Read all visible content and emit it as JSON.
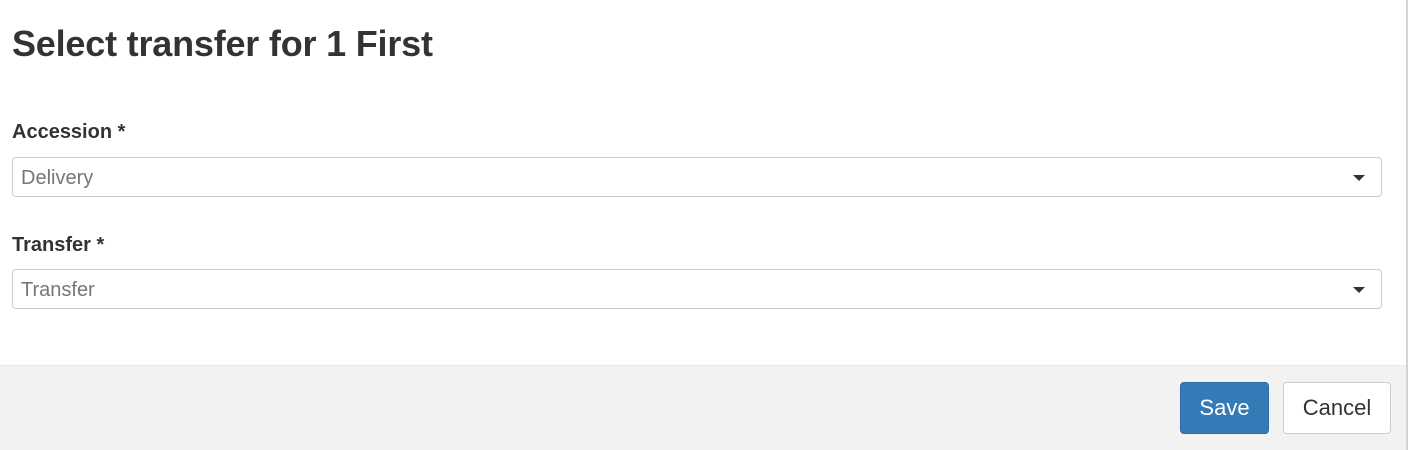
{
  "dialog": {
    "title": "Select transfer for 1 First"
  },
  "form": {
    "accession": {
      "label": "Accession *",
      "placeholder": "Delivery",
      "caret_icon": "caret-down-icon"
    },
    "transfer": {
      "label": "Transfer *",
      "placeholder": "Transfer",
      "caret_icon": "caret-down-icon"
    }
  },
  "footer": {
    "save_label": "Save",
    "cancel_label": "Cancel"
  },
  "colors": {
    "primary": "#337ab7",
    "footer_background": "#f2f2f2",
    "text": "#333333",
    "placeholder": "#777777"
  }
}
